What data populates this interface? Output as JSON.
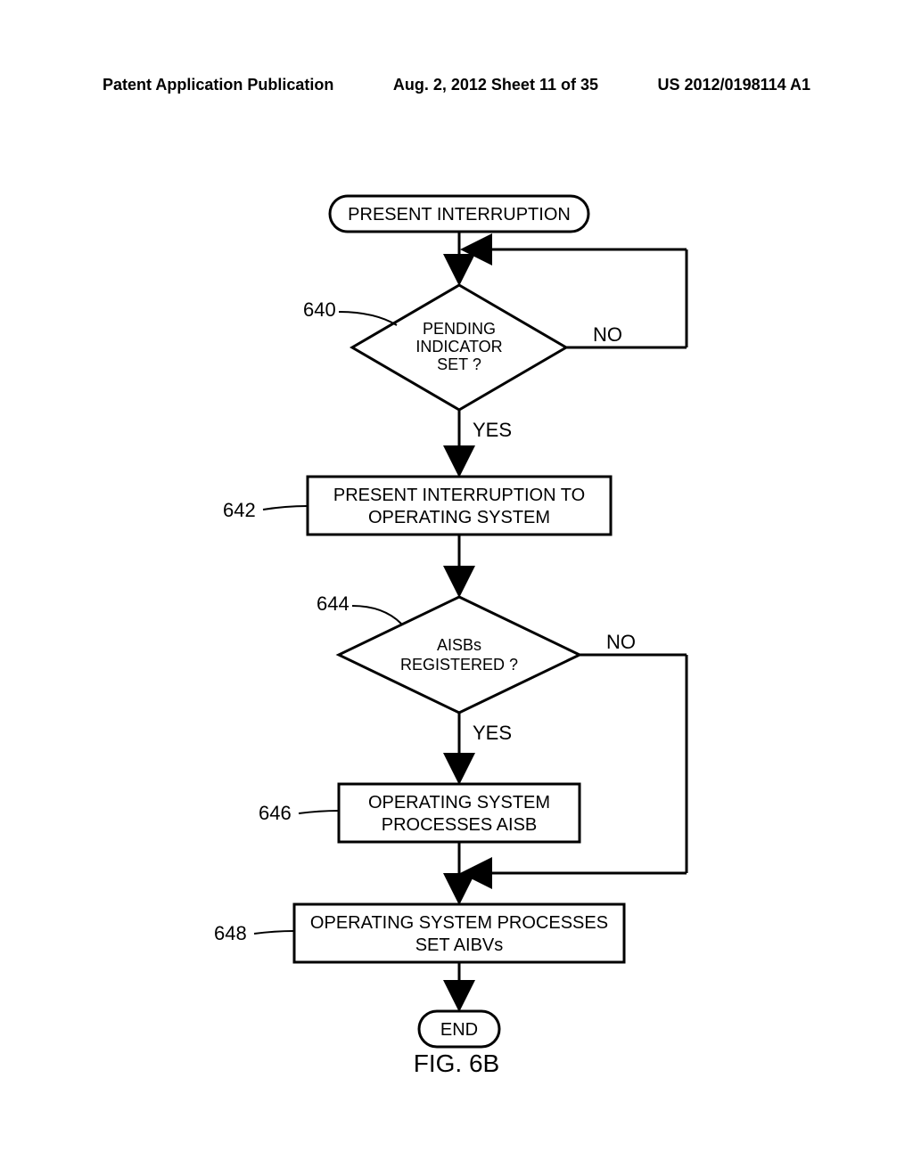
{
  "header": {
    "left": "Patent Application Publication",
    "center": "Aug. 2, 2012  Sheet 11 of 35",
    "right": "US 2012/0198114 A1"
  },
  "flowchart": {
    "start": "PRESENT INTERRUPTION",
    "decision1": {
      "ref": "640",
      "line1": "PENDING",
      "line2": "INDICATOR",
      "line3": "SET ?",
      "yes": "YES",
      "no": "NO"
    },
    "process1": {
      "ref": "642",
      "line1": "PRESENT INTERRUPTION TO",
      "line2": "OPERATING SYSTEM"
    },
    "decision2": {
      "ref": "644",
      "line1": "AISBs",
      "line2": "REGISTERED ?",
      "yes": "YES",
      "no": "NO"
    },
    "process2": {
      "ref": "646",
      "line1": "OPERATING SYSTEM",
      "line2": "PROCESSES AISB"
    },
    "process3": {
      "ref": "648",
      "line1": "OPERATING SYSTEM PROCESSES",
      "line2": "SET AIBVs"
    },
    "end": "END"
  },
  "figure": "FIG. 6B"
}
